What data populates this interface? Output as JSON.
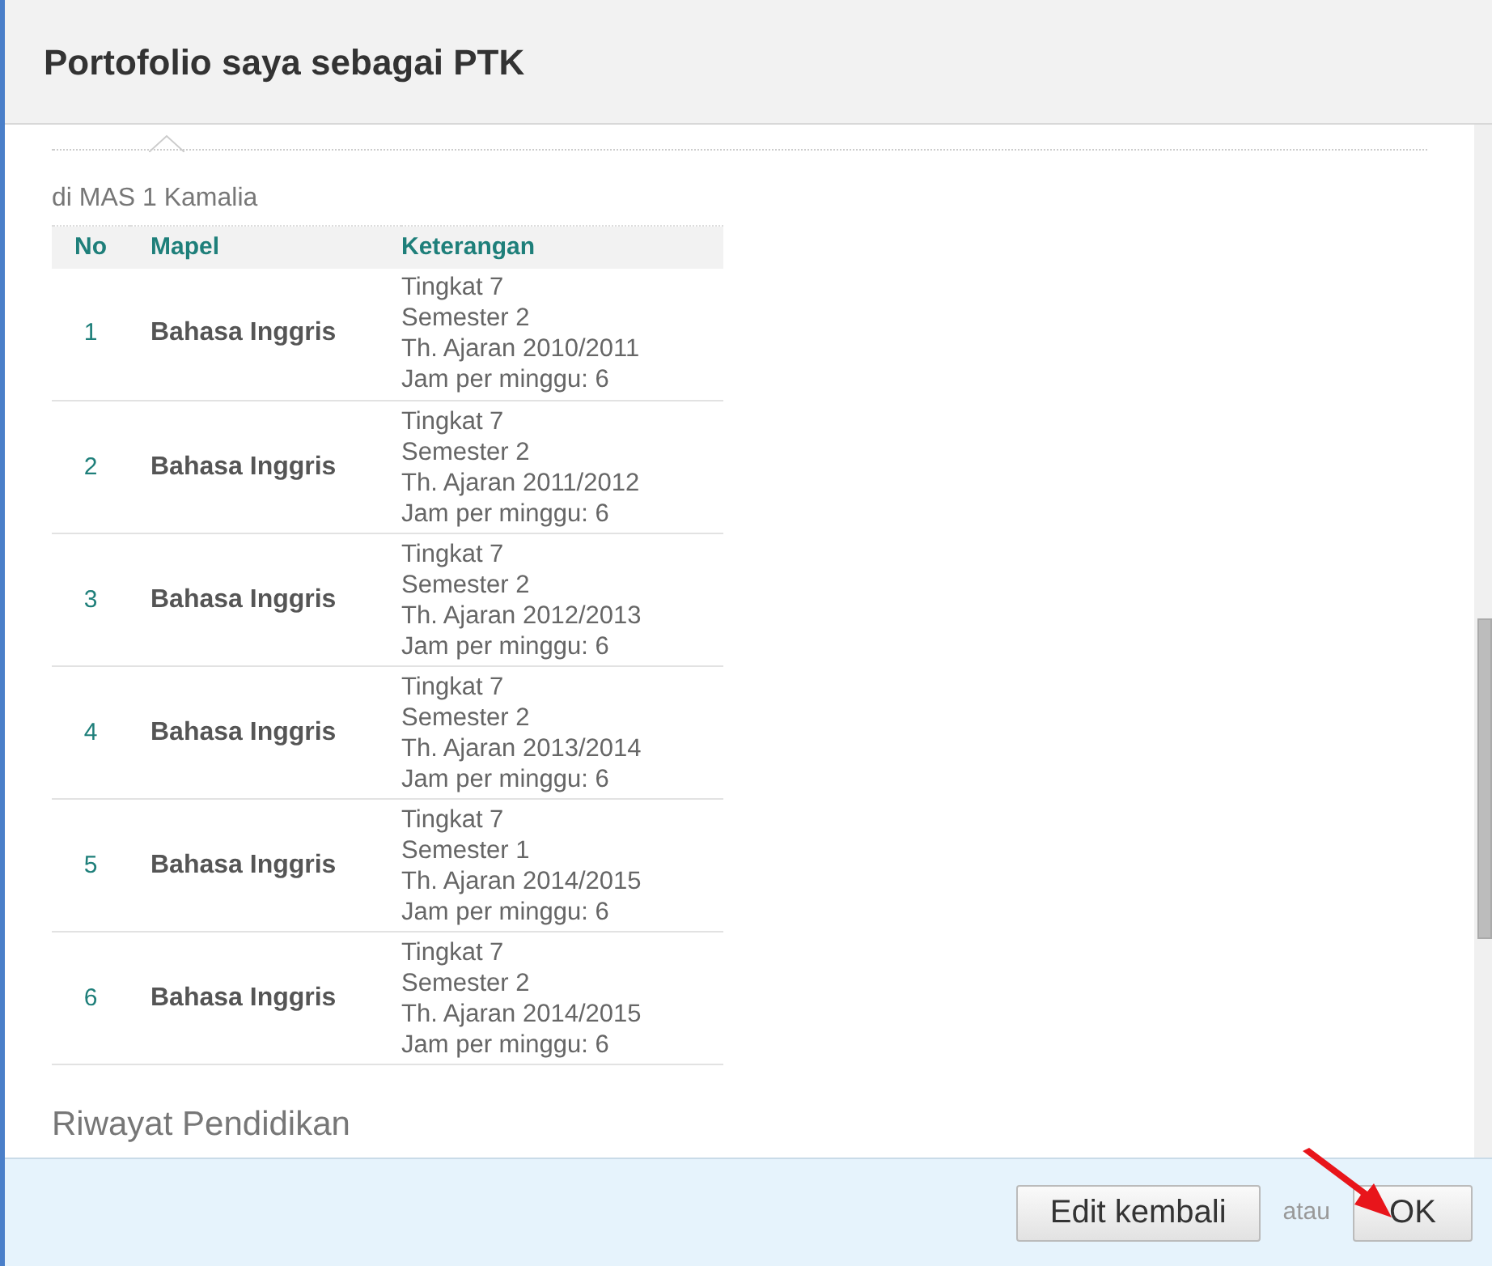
{
  "dialog": {
    "title": "Portofolio saya sebagai PTK"
  },
  "section": {
    "subtitle": "di MAS 1 Kamalia",
    "columns": [
      "No",
      "Mapel",
      "Keterangan"
    ],
    "rows": [
      {
        "no": "1",
        "mapel": "Bahasa Inggris",
        "keterangan": [
          "Tingkat 7",
          "Semester 2",
          "Th. Ajaran 2010/2011",
          "Jam per minggu: 6"
        ]
      },
      {
        "no": "2",
        "mapel": "Bahasa Inggris",
        "keterangan": [
          "Tingkat 7",
          "Semester 2",
          "Th. Ajaran 2011/2012",
          "Jam per minggu: 6"
        ]
      },
      {
        "no": "3",
        "mapel": "Bahasa Inggris",
        "keterangan": [
          "Tingkat 7",
          "Semester 2",
          "Th. Ajaran 2012/2013",
          "Jam per minggu: 6"
        ]
      },
      {
        "no": "4",
        "mapel": "Bahasa Inggris",
        "keterangan": [
          "Tingkat 7",
          "Semester 2",
          "Th. Ajaran 2013/2014",
          "Jam per minggu: 6"
        ]
      },
      {
        "no": "5",
        "mapel": "Bahasa Inggris",
        "keterangan": [
          "Tingkat 7",
          "Semester 1",
          "Th. Ajaran 2014/2015",
          "Jam per minggu: 6"
        ]
      },
      {
        "no": "6",
        "mapel": "Bahasa Inggris",
        "keterangan": [
          "Tingkat 7",
          "Semester 2",
          "Th. Ajaran 2014/2015",
          "Jam per minggu: 6"
        ]
      }
    ]
  },
  "next_heading": "Riwayat Pendidikan",
  "footer": {
    "edit_button": "Edit kembali",
    "separator": "atau",
    "ok_button": "OK"
  }
}
